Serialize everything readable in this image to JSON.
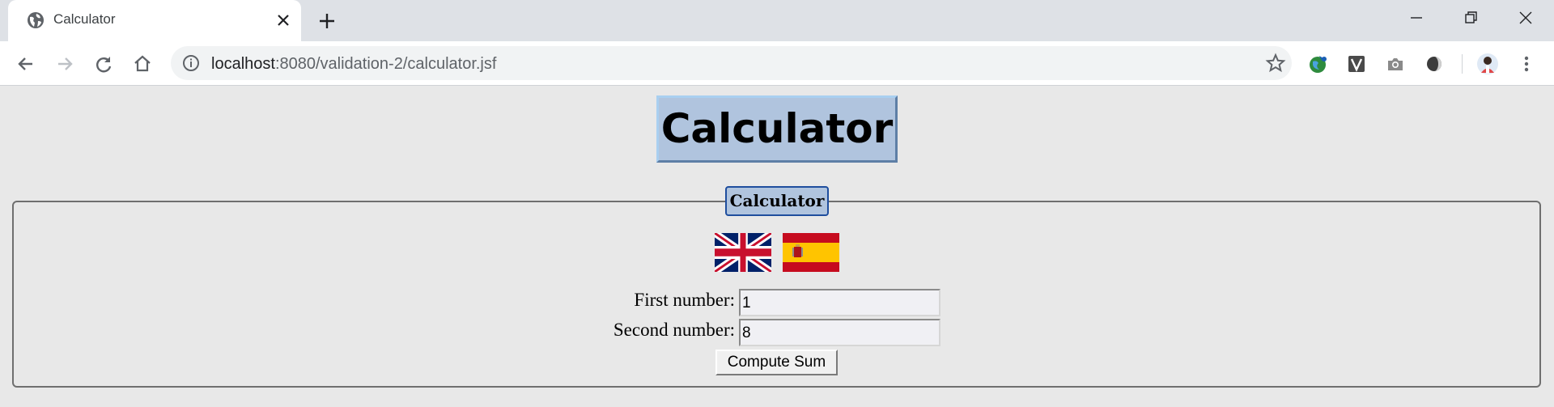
{
  "browser": {
    "tab_title": "Calculator",
    "url_host": "localhost",
    "url_path": ":8080/validation-2/calculator.jsf"
  },
  "page": {
    "heading": "Calculator",
    "panel_legend": "Calculator",
    "flags": [
      "uk-flag",
      "spain-flag"
    ],
    "first_label": "First number:",
    "first_value": "1",
    "second_label": "Second number:",
    "second_value": "8",
    "button_label": "Compute Sum"
  },
  "colors": {
    "heading_bg": "#b0c4de",
    "legend_border": "#1f4e9e",
    "page_bg": "#e8e8e8"
  }
}
